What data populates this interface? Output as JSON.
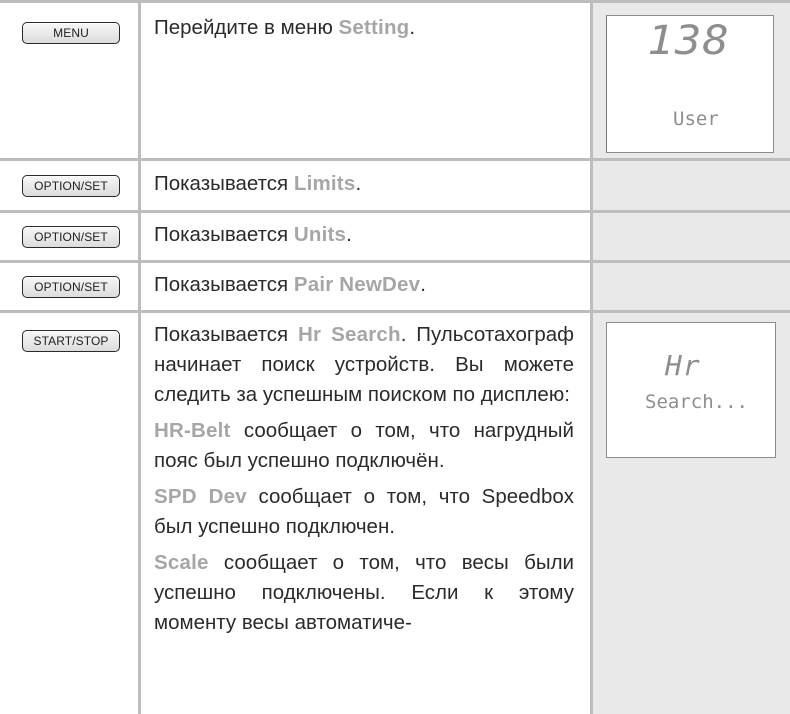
{
  "rows": [
    {
      "button": "MENU",
      "text_before": "Перейдите в меню ",
      "highlight": "Setting",
      "text_after": ".",
      "display": {
        "top": "138",
        "bottom": "User"
      }
    },
    {
      "button": "OPTION/SET",
      "text_before": "Показывается ",
      "highlight": "Limits",
      "text_after": "."
    },
    {
      "button": "OPTION/SET",
      "text_before": "Показывается ",
      "highlight": "Units",
      "text_after": "."
    },
    {
      "button": "OPTION/SET",
      "text_before": "Показывается ",
      "highlight": "Pair NewDev",
      "text_after": "."
    },
    {
      "button": "START/STOP",
      "intro_before": "Показывается ",
      "intro_highlight": "Hr Search",
      "intro_after": ". Пульсотахограф начинает поиск устройств. Вы можете следить за успешным поиском по дисплею:",
      "items": [
        {
          "highlight": "HR-Belt",
          "text": " сообщает о том, что нагрудный пояс был успешно подключён."
        },
        {
          "highlight": "SPD Dev",
          "text": " сообщает о том, что Speedbox был успешно подключен."
        },
        {
          "highlight": "Scale",
          "text": " сообщает о том, что весы были успешно подключены. Если к этому моменту весы автоматиче-"
        }
      ],
      "display": {
        "top": "Hr",
        "bottom": "Search..."
      }
    }
  ],
  "colors": {
    "highlight": "#a6a6a6",
    "shade": "#e9e9e9",
    "separator": "#bdbdbd"
  }
}
